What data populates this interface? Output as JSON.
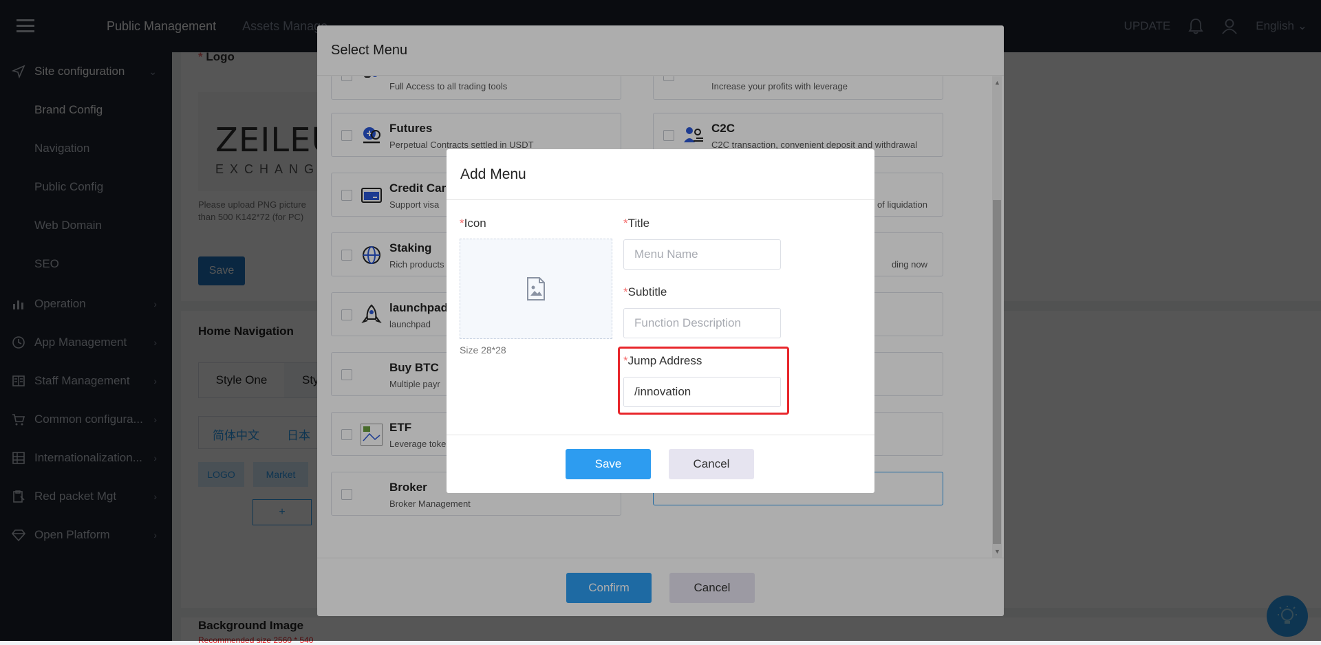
{
  "topbar": {
    "nav": [
      "Public Management",
      "Assets Manage"
    ],
    "update_label": "UPDATE",
    "language": "English"
  },
  "sidebar": {
    "items": [
      {
        "label": "Site configuration",
        "icon": "send-icon",
        "expanded": true
      },
      {
        "label": "Operation",
        "icon": "bar-chart-icon"
      },
      {
        "label": "App Management",
        "icon": "clock-icon"
      },
      {
        "label": "Staff Management",
        "icon": "book-icon"
      },
      {
        "label": "Common configura...",
        "icon": "cart-icon"
      },
      {
        "label": "Internationalization...",
        "icon": "grid-icon"
      },
      {
        "label": "Red packet Mgt",
        "icon": "clipboard-icon"
      },
      {
        "label": "Open Platform",
        "icon": "diamond-icon"
      }
    ],
    "sub_items": [
      "Brand Config",
      "Navigation",
      "Public Config",
      "Web Domain",
      "SEO"
    ]
  },
  "content": {
    "logo_label": "Logo",
    "logo_text": "ZEILEUN",
    "logo_sub": "EXCHANG",
    "upload_hint_1": "Please upload PNG picture",
    "upload_hint_2": "than 500 K142*72 (for PC)",
    "save_label": "Save",
    "home_nav_title": "Home Navigation",
    "style_tabs": [
      "Style One",
      "Sty"
    ],
    "lang_tabs": [
      "简体中文",
      "日本"
    ],
    "chips": [
      "LOGO",
      "Market"
    ],
    "plus_label": "+",
    "bg_title": "Background Image",
    "bg_hint": "Recommended size 2560 * 540"
  },
  "select_menu": {
    "title": "Select Menu",
    "left_options": [
      {
        "title": "",
        "subtitle": "Full Access to all trading tools"
      },
      {
        "title": "Futures",
        "subtitle": "Perpetual Contracts settled in USDT"
      },
      {
        "title": "Credit Car",
        "subtitle": "Support visa"
      },
      {
        "title": "Staking",
        "subtitle": "Rich products"
      },
      {
        "title": "launchpad",
        "subtitle": "launchpad"
      },
      {
        "title": "Buy BTC",
        "subtitle": "Multiple payr"
      },
      {
        "title": "ETF",
        "subtitle": "Leverage toke"
      },
      {
        "title": "Broker",
        "subtitle": "Broker Management"
      }
    ],
    "right_options": [
      {
        "title": "",
        "subtitle": "Increase your profits with leverage"
      },
      {
        "title": "C2C",
        "subtitle": "C2C transaction, convenient deposit and withdrawal"
      },
      {
        "title": "",
        "subtitle": "of liquidation"
      },
      {
        "title": "",
        "subtitle": "ding now"
      }
    ],
    "confirm_label": "Confirm",
    "cancel_label": "Cancel"
  },
  "add_menu": {
    "title": "Add Menu",
    "icon_label": "Icon",
    "size_hint": "Size 28*28",
    "title_label": "Title",
    "title_placeholder": "Menu Name",
    "subtitle_label": "Subtitle",
    "subtitle_placeholder": "Function Description",
    "jump_label": "Jump Address",
    "jump_value": "/innovation",
    "save_label": "Save",
    "cancel_label": "Cancel",
    "required_mark": "*"
  },
  "colors": {
    "accent": "#2d9cf0",
    "highlight": "#e8262b",
    "sidebar_bg": "#1e2532"
  }
}
